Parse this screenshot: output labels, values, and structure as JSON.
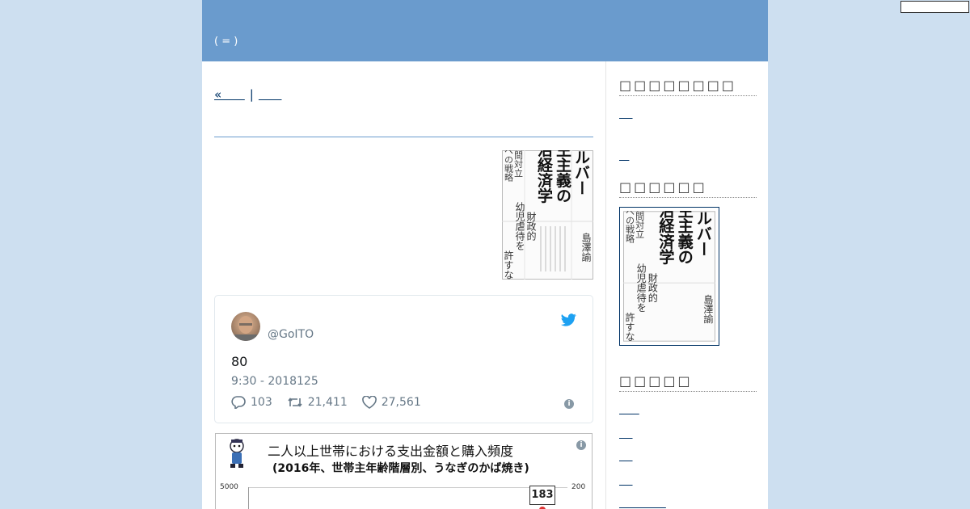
{
  "header": {
    "subtitle": "( = )"
  },
  "nav": {
    "prev_label": "«      ",
    "separator": "|",
    "next_label": "      "
  },
  "book": {
    "title": "シルバー民主主義の政治経済学",
    "subtitle": "世代間対立克服への戦略",
    "tagline": "財政的幼児虐待を許すな",
    "author": "島澤諭"
  },
  "tweet": {
    "handle": "@GoITO",
    "text": "80",
    "time": "9:30 - 2018125",
    "replies": "103",
    "retweets": "21,411",
    "likes": "27,561"
  },
  "chart_card": {
    "title": "二人以上世帯における支出金額と購入頻度",
    "subtitle": "(2016年、世帯主年齢階層別、うなぎのかば焼き)",
    "y_left_top": "5000",
    "y_right_top": "200",
    "highlight": "183"
  },
  "sidebar": {
    "heading1": "□□□□□□□□",
    "heading2": "□□□□□□",
    "heading3": "□□□□□",
    "links_top": [
      "    ",
      "   "
    ],
    "links_bottom": [
      "      ",
      "    ",
      "    ",
      "    ",
      "              "
    ]
  },
  "colors": {
    "header_bg": "#6a9bcd",
    "page_bg": "#cddff0",
    "link": "#003366",
    "twitter_blue": "#1da1f2"
  }
}
